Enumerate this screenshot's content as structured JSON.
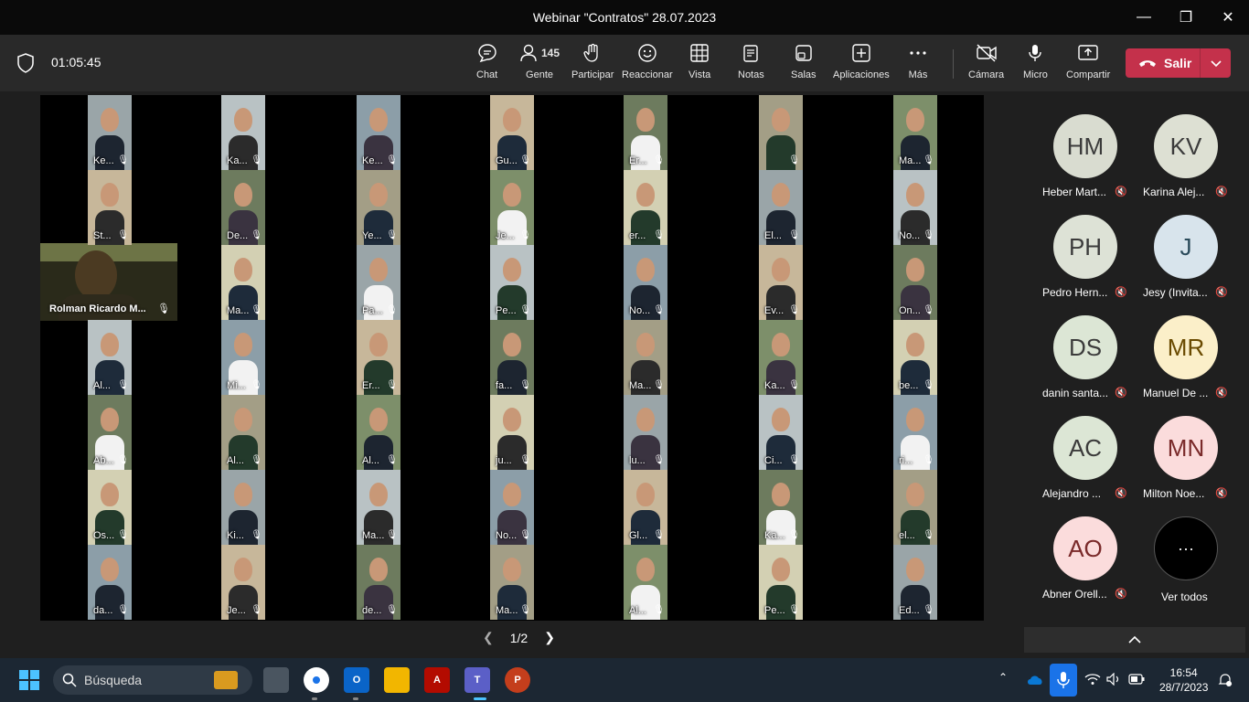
{
  "window": {
    "title": "Webinar \"Contratos\" 28.07.2023",
    "minimize": "—",
    "maximize": "❐",
    "close": "✕"
  },
  "toolbar": {
    "timer": "01:05:45",
    "buttons": [
      {
        "label": "Chat",
        "icon": "chat-icon"
      },
      {
        "label": "Gente",
        "icon": "people-icon",
        "badge": "145"
      },
      {
        "label": "Participar",
        "icon": "raise-hand-icon"
      },
      {
        "label": "Reaccionar",
        "icon": "react-icon"
      },
      {
        "label": "Vista",
        "icon": "view-icon"
      },
      {
        "label": "Notas",
        "icon": "notes-icon"
      },
      {
        "label": "Salas",
        "icon": "rooms-icon"
      },
      {
        "label": "Aplicaciones",
        "icon": "apps-icon"
      },
      {
        "label": "Más",
        "icon": "more-icon"
      },
      {
        "label": "Cámara",
        "icon": "camera-off-icon"
      },
      {
        "label": "Micro",
        "icon": "mic-icon"
      },
      {
        "label": "Compartir",
        "icon": "share-icon"
      }
    ],
    "leave_label": "Salir"
  },
  "grid": {
    "featured": "Rolman Ricardo M...",
    "columns": [
      [
        "Ke...",
        "St...",
        "",
        "Al...",
        "Ab...",
        "Os...",
        "da..."
      ],
      [
        "Ka...",
        "De...",
        "Ma...",
        "Mi...",
        "Al...",
        "Ki...",
        "Je..."
      ],
      [
        "Ke...",
        "Ye...",
        "Pa...",
        "Er...",
        "Al...",
        "Ma...",
        "de..."
      ],
      [
        "Gu...",
        "Je...",
        "Pe...",
        "fa...",
        "ju...",
        "No...",
        "Ma..."
      ],
      [
        "Er...",
        "er...",
        "No...",
        "Ma...",
        "lu...",
        "Gl...",
        "Al..."
      ],
      [
        "",
        "El...",
        "Ev...",
        "Ka...",
        "Ci...",
        "Ka...",
        "Pe..."
      ],
      [
        "Ma...",
        "No...",
        "On...",
        "be...",
        "ri...",
        "el...",
        "Ed..."
      ]
    ],
    "pager": "1/2"
  },
  "roster": {
    "people": [
      {
        "initials": "HM",
        "name": "Heber Mart...",
        "color": "#d9dcd0",
        "text": "#3b3b3b"
      },
      {
        "initials": "KV",
        "name": "Karina Alej...",
        "color": "#dde0d3",
        "text": "#3b3b3b"
      },
      {
        "initials": "PH",
        "name": "Pedro Hern...",
        "color": "#dde2d6",
        "text": "#3b3b3b"
      },
      {
        "initials": "J",
        "name": "Jesy (Invita...",
        "color": "#d8e4ec",
        "text": "#2a4a5a"
      },
      {
        "initials": "DS",
        "name": "danin santa...",
        "color": "#dce6d5",
        "text": "#3b3b3b"
      },
      {
        "initials": "MR",
        "name": "Manuel De ...",
        "color": "#fbefc9",
        "text": "#6a4a00"
      },
      {
        "initials": "AC",
        "name": "Alejandro ...",
        "color": "#dce6d5",
        "text": "#3b3b3b"
      },
      {
        "initials": "MN",
        "name": "Milton Noe...",
        "color": "#fbdcdc",
        "text": "#7a2a2a"
      },
      {
        "initials": "AO",
        "name": "Abner Orell...",
        "color": "#fbdcdc",
        "text": "#7a2a2a"
      }
    ],
    "more_label": "Ver todos",
    "more_dots": "···"
  },
  "taskbar": {
    "search_placeholder": "Búsqueda",
    "time": "16:54",
    "date": "28/7/2023"
  },
  "colors": {
    "leave": "#c4314b",
    "titlebar": "#0a0a0a",
    "toolbar": "#292929",
    "taskbar": "#1c2733"
  }
}
